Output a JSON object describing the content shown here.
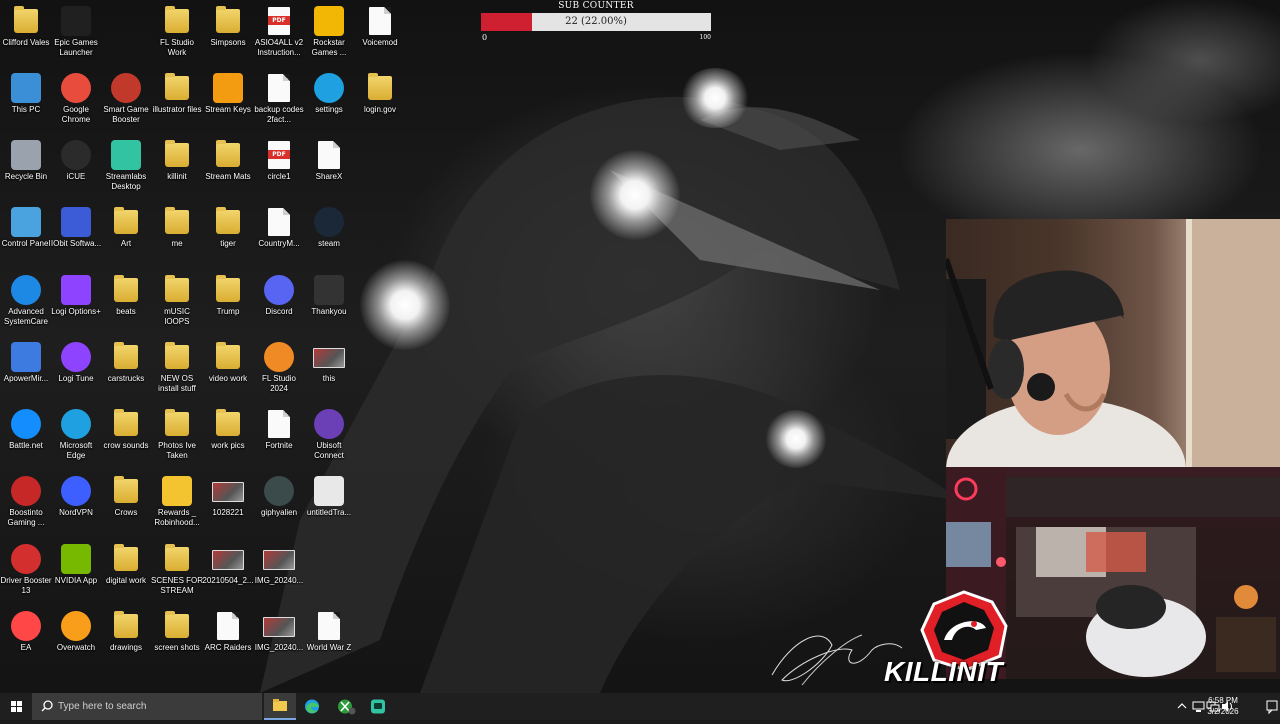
{
  "desktop": {
    "icons": [
      {
        "label": "Clifford Vales",
        "icon": "user-folder-icon"
      },
      {
        "label": "Epic Games Launcher",
        "icon": "epic-games-icon"
      },
      {
        "label": "FL Studio Work",
        "icon": "folder-icon"
      },
      {
        "label": "Simpsons",
        "icon": "folder-icon"
      },
      {
        "label": "ASIO4ALL v2 Instruction...",
        "icon": "pdf-icon"
      },
      {
        "label": "Rockstar Games ...",
        "icon": "rockstar-icon"
      },
      {
        "label": "Voicemod",
        "icon": "file-icon"
      },
      {
        "label": "This PC",
        "icon": "computer-icon"
      },
      {
        "label": "Google Chrome",
        "icon": "chrome-icon"
      },
      {
        "label": "Smart Game Booster",
        "icon": "smart-game-booster-icon"
      },
      {
        "label": "illustrator files",
        "icon": "folder-icon"
      },
      {
        "label": "Stream Keys",
        "icon": "key-icon"
      },
      {
        "label": "backup codes 2fact...",
        "icon": "file-icon"
      },
      {
        "label": "settings",
        "icon": "edge-icon"
      },
      {
        "label": "login.gov",
        "icon": "folder-icon"
      },
      {
        "label": "Recycle Bin",
        "icon": "recycle-bin-icon"
      },
      {
        "label": "iCUE",
        "icon": "icue-icon"
      },
      {
        "label": "Streamlabs Desktop",
        "icon": "streamlabs-icon"
      },
      {
        "label": "killinit",
        "icon": "folder-icon"
      },
      {
        "label": "Stream Mats",
        "icon": "folder-icon"
      },
      {
        "label": "circle1",
        "icon": "pdf-icon"
      },
      {
        "label": "ShareX",
        "icon": "file-icon"
      },
      {
        "label": "Control Panel",
        "icon": "control-panel-icon"
      },
      {
        "label": "IObit Softwa...",
        "icon": "iobit-icon"
      },
      {
        "label": "Art",
        "icon": "folder-icon"
      },
      {
        "label": "me",
        "icon": "folder-icon"
      },
      {
        "label": "tiger",
        "icon": "folder-icon"
      },
      {
        "label": "CountryM...",
        "icon": "file-icon"
      },
      {
        "label": "steam",
        "icon": "steam-icon"
      },
      {
        "label": "Advanced SystemCare",
        "icon": "advanced-systemcare-icon"
      },
      {
        "label": "Logi Options+",
        "icon": "logi-options-icon"
      },
      {
        "label": "beats",
        "icon": "folder-icon"
      },
      {
        "label": "mUSIC lOOPS",
        "icon": "folder-icon"
      },
      {
        "label": "Trump",
        "icon": "folder-icon"
      },
      {
        "label": "Discord",
        "icon": "discord-icon"
      },
      {
        "label": "Thankyou",
        "icon": "thankyou-icon"
      },
      {
        "label": "ApowerMir...",
        "icon": "apowermirror-icon"
      },
      {
        "label": "Logi Tune",
        "icon": "logi-tune-icon"
      },
      {
        "label": "carstrucks",
        "icon": "folder-icon"
      },
      {
        "label": "NEW OS install stuff",
        "icon": "folder-icon"
      },
      {
        "label": "video work",
        "icon": "folder-icon"
      },
      {
        "label": "FL Studio 2024",
        "icon": "fl-studio-icon"
      },
      {
        "label": "this",
        "icon": "image-icon"
      },
      {
        "label": "Battle.net",
        "icon": "battlenet-icon"
      },
      {
        "label": "Microsoft Edge",
        "icon": "edge-icon"
      },
      {
        "label": "crow sounds",
        "icon": "folder-icon"
      },
      {
        "label": "Photos Ive Taken",
        "icon": "folder-icon"
      },
      {
        "label": "work pics",
        "icon": "folder-icon"
      },
      {
        "label": "Fortnite",
        "icon": "file-icon"
      },
      {
        "label": "Ubisoft Connect",
        "icon": "ubisoft-icon"
      },
      {
        "label": "Boostinto Gaming ...",
        "icon": "boost-icon"
      },
      {
        "label": "NordVPN",
        "icon": "nordvpn-icon"
      },
      {
        "label": "Crows",
        "icon": "folder-icon"
      },
      {
        "label": "Rewards _ Robinhood...",
        "icon": "star-icon"
      },
      {
        "label": "1028221",
        "icon": "image-icon"
      },
      {
        "label": "giphyalien",
        "icon": "alien-icon"
      },
      {
        "label": "untitledTra...",
        "icon": "video-icon"
      },
      {
        "label": "Driver Booster 13",
        "icon": "driver-booster-icon"
      },
      {
        "label": "NVIDIA App",
        "icon": "nvidia-icon"
      },
      {
        "label": "digital work",
        "icon": "folder-icon"
      },
      {
        "label": "SCENES FOR STREAM",
        "icon": "folder-icon"
      },
      {
        "label": "20210504_2...",
        "icon": "image-icon"
      },
      {
        "label": "IMG_20240...",
        "icon": "image-icon"
      },
      {
        "label": "EA",
        "icon": "ea-icon"
      },
      {
        "label": "Overwatch",
        "icon": "overwatch-icon"
      },
      {
        "label": "drawings",
        "icon": "folder-icon"
      },
      {
        "label": "screen shots",
        "icon": "folder-icon"
      },
      {
        "label": "ARC Raiders",
        "icon": "file-icon"
      },
      {
        "label": "IMG_20240...",
        "icon": "image-icon"
      },
      {
        "label": "World War Z",
        "icon": "file-icon"
      }
    ]
  },
  "sub_counter": {
    "title": "SUB COUNTER",
    "text": "22 (22.00%)",
    "current": 22,
    "progress_fraction": 0.22,
    "min_label": "0",
    "max_label": "100",
    "fill_color": "#cf2032"
  },
  "overlay": {
    "brand_text": "KILLINIT",
    "webcam_main_icon": "webcam-feed-icon",
    "webcam_desk_icon": "desk-cam-feed-icon"
  },
  "taskbar": {
    "search_placeholder": "Type here to search",
    "apps": [
      {
        "name": "file-explorer",
        "icon": "folder-icon",
        "active": true
      },
      {
        "name": "edge",
        "icon": "edge-icon",
        "active": false
      },
      {
        "name": "xbox",
        "icon": "xbox-icon",
        "active": false,
        "badge": "3"
      },
      {
        "name": "streamlabs",
        "icon": "streamlabs-icon",
        "active": false
      }
    ],
    "clock_time": "6:58 PM",
    "clock_date": "3/2/2026"
  },
  "colors": {
    "taskbar_bg": "#1f1f1f",
    "search_bg": "#3b3b3b",
    "accent": "#cf2032"
  }
}
